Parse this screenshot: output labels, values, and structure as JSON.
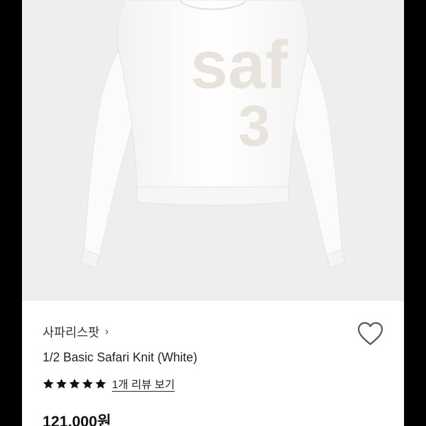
{
  "product": {
    "brand": "사파리스팟",
    "brand_chevron": "›",
    "name": "1/2 Basic Safari Knit (White)",
    "rating": 5,
    "rating_max": 5,
    "review_link": "1개 리뷰 보기",
    "price": "121,000원",
    "graphic_text": "saf",
    "graphic_number": "3",
    "colors": {
      "photo_bg": "#eeeeee",
      "sweater": "#ffffff",
      "print": "#e8e4dd",
      "star": "#111111"
    }
  },
  "icons": {
    "wishlist": "heart-outline-icon",
    "star": "star-filled-icon"
  }
}
